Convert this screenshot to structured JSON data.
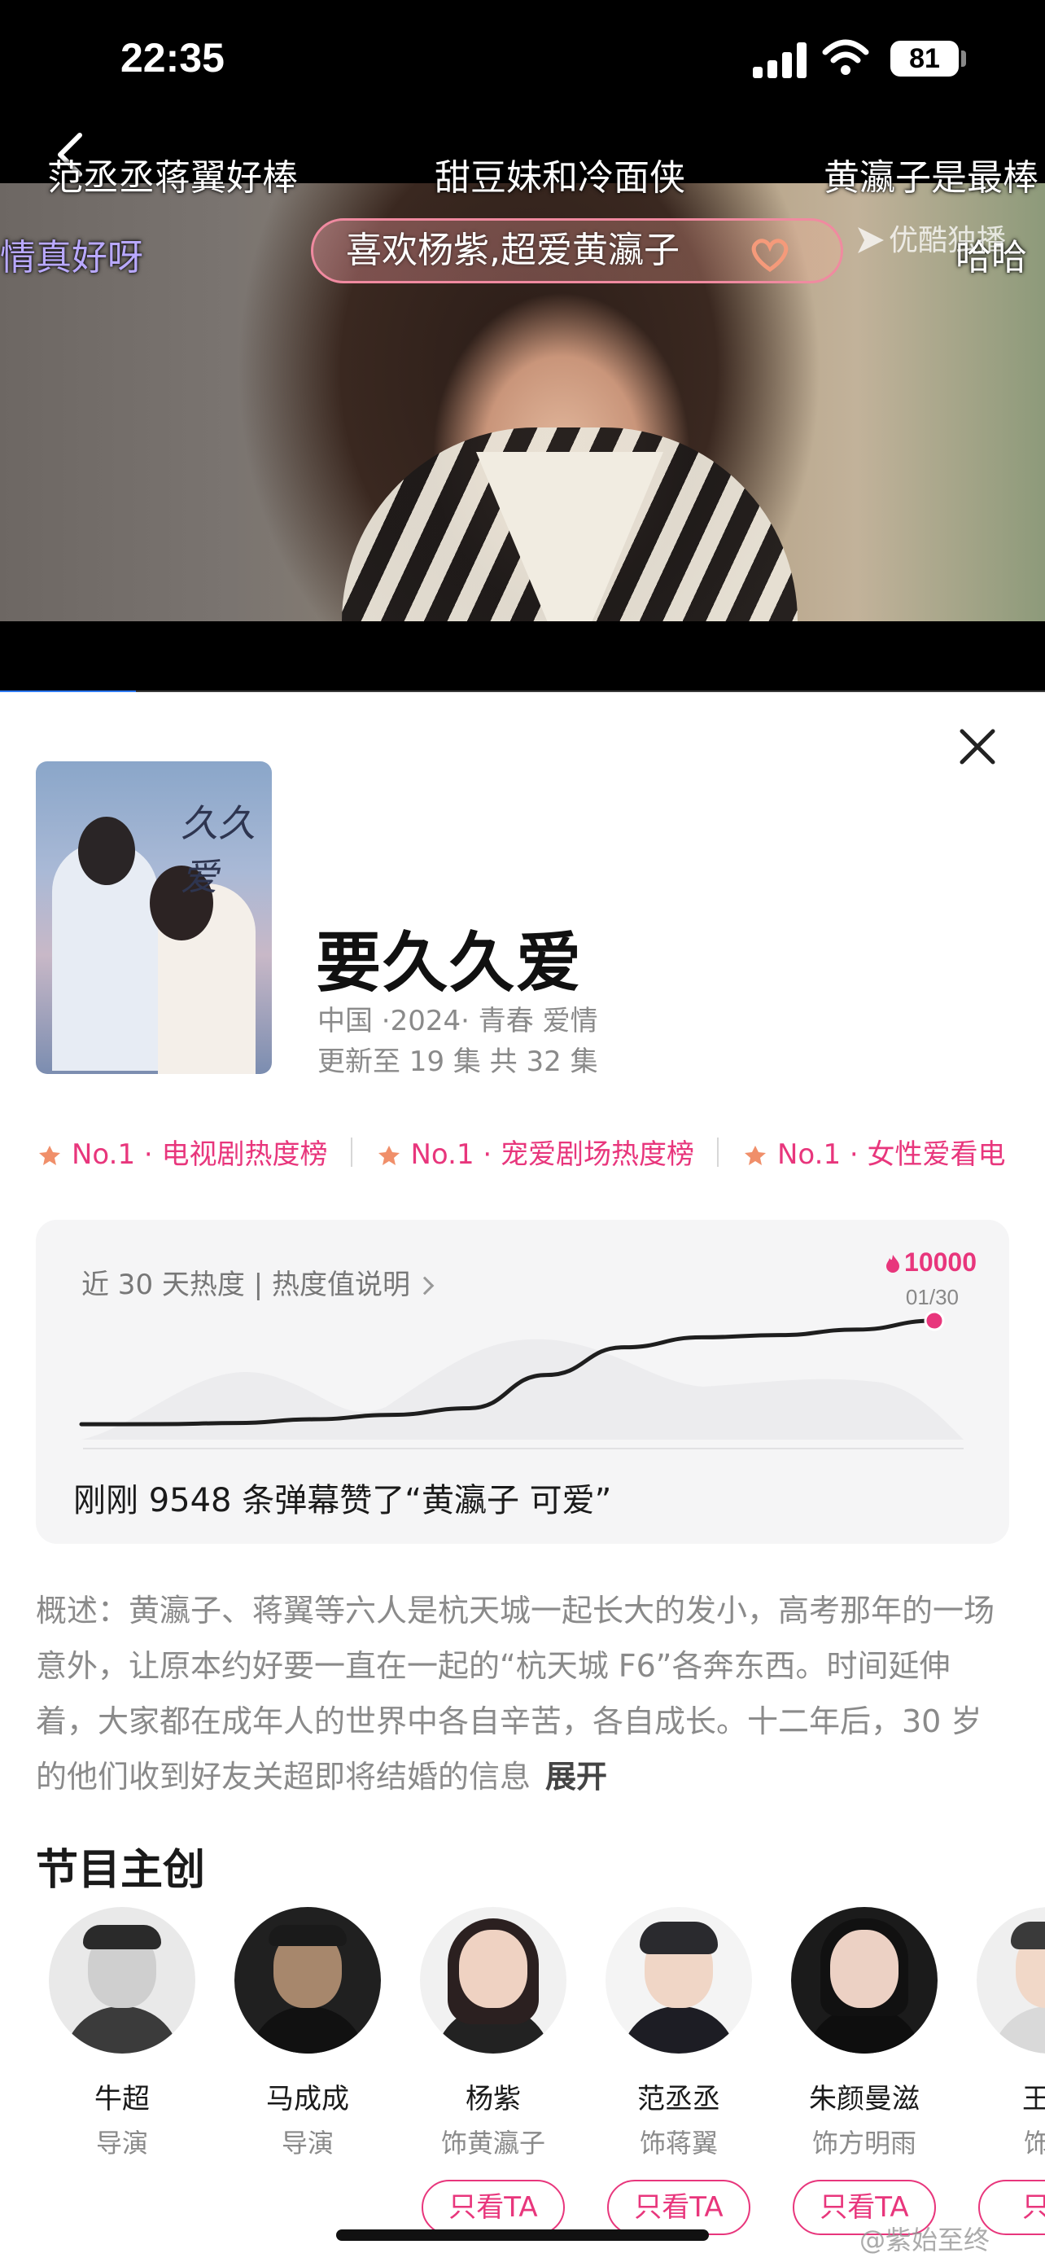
{
  "status_bar": {
    "time": "22:35",
    "battery": "81"
  },
  "player": {
    "danmu": [
      "范丞丞蒋翼好棒",
      "甜豆妹和冷面侠",
      "黄瀛子是最棒",
      "情真好呀",
      "哈哈"
    ],
    "featured_danmu": "喜欢杨紫,超爱黄瀛子",
    "watermark": "优酷独播",
    "progress": 0.13
  },
  "show": {
    "poster_title": "久久爱",
    "title": "要久久爱",
    "meta": "中国 ·2024· 青春 爱情",
    "episodes": "更新至 19 集 共 32 集"
  },
  "rankings": [
    "No.1 · 电视剧热度榜",
    "No.1 · 宠爱剧场热度榜",
    "No.1 · 女性爱看电"
  ],
  "heat": {
    "label": "近 30 天热度 | 热度值说明",
    "peak_value": "10000",
    "peak_date": "01/30",
    "caption": "刚刚 9548 条弹幕赞了“黄瀛子 可爱”"
  },
  "chart_data": {
    "type": "line",
    "series": [
      {
        "values": [
          650,
          660,
          760,
          1100,
          1500,
          2100,
          5100,
          7600,
          8500,
          8700,
          9200,
          10000
        ]
      }
    ],
    "ylim": [
      0,
      10000
    ],
    "grid": false
  },
  "synopsis": {
    "text": "概述：黄瀛子、蒋翼等六人是杭天城一起长大的发小，高考那年的一场意外，让原本约好要一直在一起的“杭天城 F6”各奔东西。时间延伸着，大家都在成年人的世界中各自辛苦，各自成长。十二年后，30 岁的他们收到好友关超即将结婚的信息",
    "expand_label": "展开"
  },
  "creators_section": {
    "title": "节目主创",
    "people": [
      {
        "name": "牛超",
        "role": "导演"
      },
      {
        "name": "马成成",
        "role": "导演"
      },
      {
        "name": "杨紫",
        "role": "饰黄瀛子",
        "button": "只看TA"
      },
      {
        "name": "范丞丞",
        "role": "饰蒋翼",
        "button": "只看TA"
      },
      {
        "name": "朱颜曼滋",
        "role": "饰方明雨",
        "button": "只看TA"
      },
      {
        "name": "王鹤",
        "role": "饰廖",
        "button": "只看"
      }
    ]
  },
  "watermark_footer": "@紫始至终",
  "colors": {
    "accent": "#e8367c",
    "progress": "#2f7bff",
    "card": "#f5f5f6"
  }
}
